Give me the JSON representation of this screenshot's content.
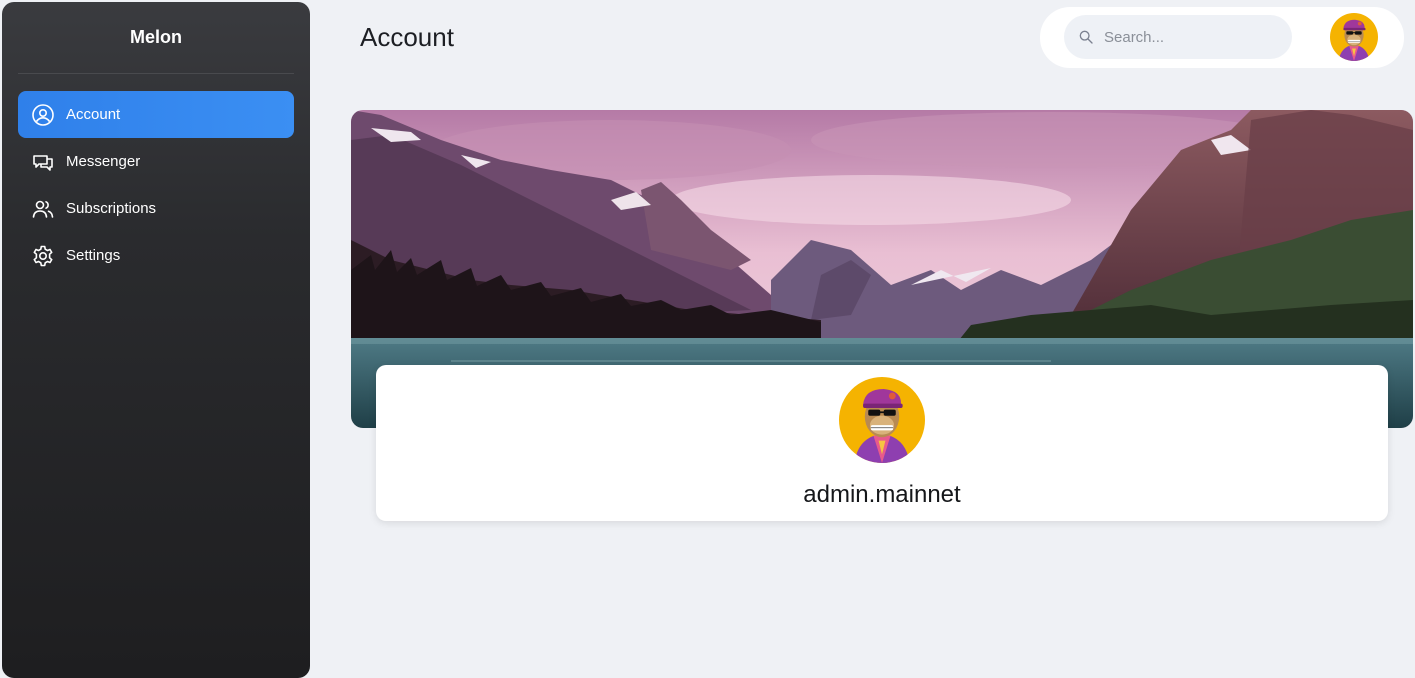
{
  "app": {
    "brand": "Melon"
  },
  "sidebar": {
    "items": [
      {
        "label": "Account",
        "icon": "user-circle-icon",
        "active": true
      },
      {
        "label": "Messenger",
        "icon": "chat-bubbles-icon",
        "active": false
      },
      {
        "label": "Subscriptions",
        "icon": "users-icon",
        "active": false
      },
      {
        "label": "Settings",
        "icon": "gear-icon",
        "active": false
      }
    ]
  },
  "header": {
    "title": "Account",
    "search": {
      "placeholder": "Search...",
      "value": ""
    },
    "avatar_icon": "ape-avatar-icon"
  },
  "profile": {
    "username": "admin.mainnet",
    "avatar_icon": "ape-avatar-icon",
    "banner": "mountain-lake-banner"
  },
  "colors": {
    "accent": "#2f80ea",
    "sidebar_bg": "#242527",
    "page_bg": "#eff1f5",
    "avatar_bg": "#f4b400"
  }
}
